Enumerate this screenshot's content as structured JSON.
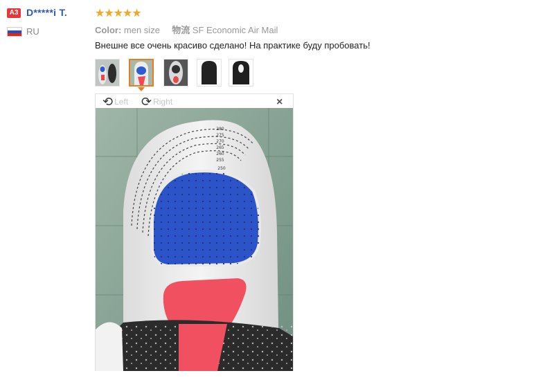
{
  "reviewer": {
    "badge": "A3",
    "name": "D*****i T.",
    "country": "RU",
    "flag_colors": [
      "#ffffff",
      "#2b4cb3",
      "#d52b1e"
    ]
  },
  "rating": {
    "stars": "★★★★★",
    "value": 5,
    "max": 5,
    "color": "#f5a623"
  },
  "order_info": {
    "color_label": "Color:",
    "color_value": "men size",
    "shipping_label": "物流",
    "shipping_value": "SF Economic Air Mail"
  },
  "review_text": "Внешне все очень красиво сделано! На практике буду пробовать!",
  "thumbnails": [
    {
      "name": "insole-photo-1",
      "active": false
    },
    {
      "name": "insole-photo-2",
      "active": true
    },
    {
      "name": "insole-photo-3",
      "active": false
    },
    {
      "name": "insole-photo-4",
      "active": false
    },
    {
      "name": "insole-photo-5",
      "active": false
    }
  ],
  "viewer": {
    "rotate_left_label": "Left",
    "rotate_right_label": "Right",
    "close_symbol": "×",
    "size_marks": [
      "280",
      "275",
      "270",
      "265",
      "260",
      "255",
      "250"
    ]
  },
  "colors": {
    "accent": "#e87d22",
    "name_link": "#2b58b8",
    "badge": "#e4393c"
  }
}
